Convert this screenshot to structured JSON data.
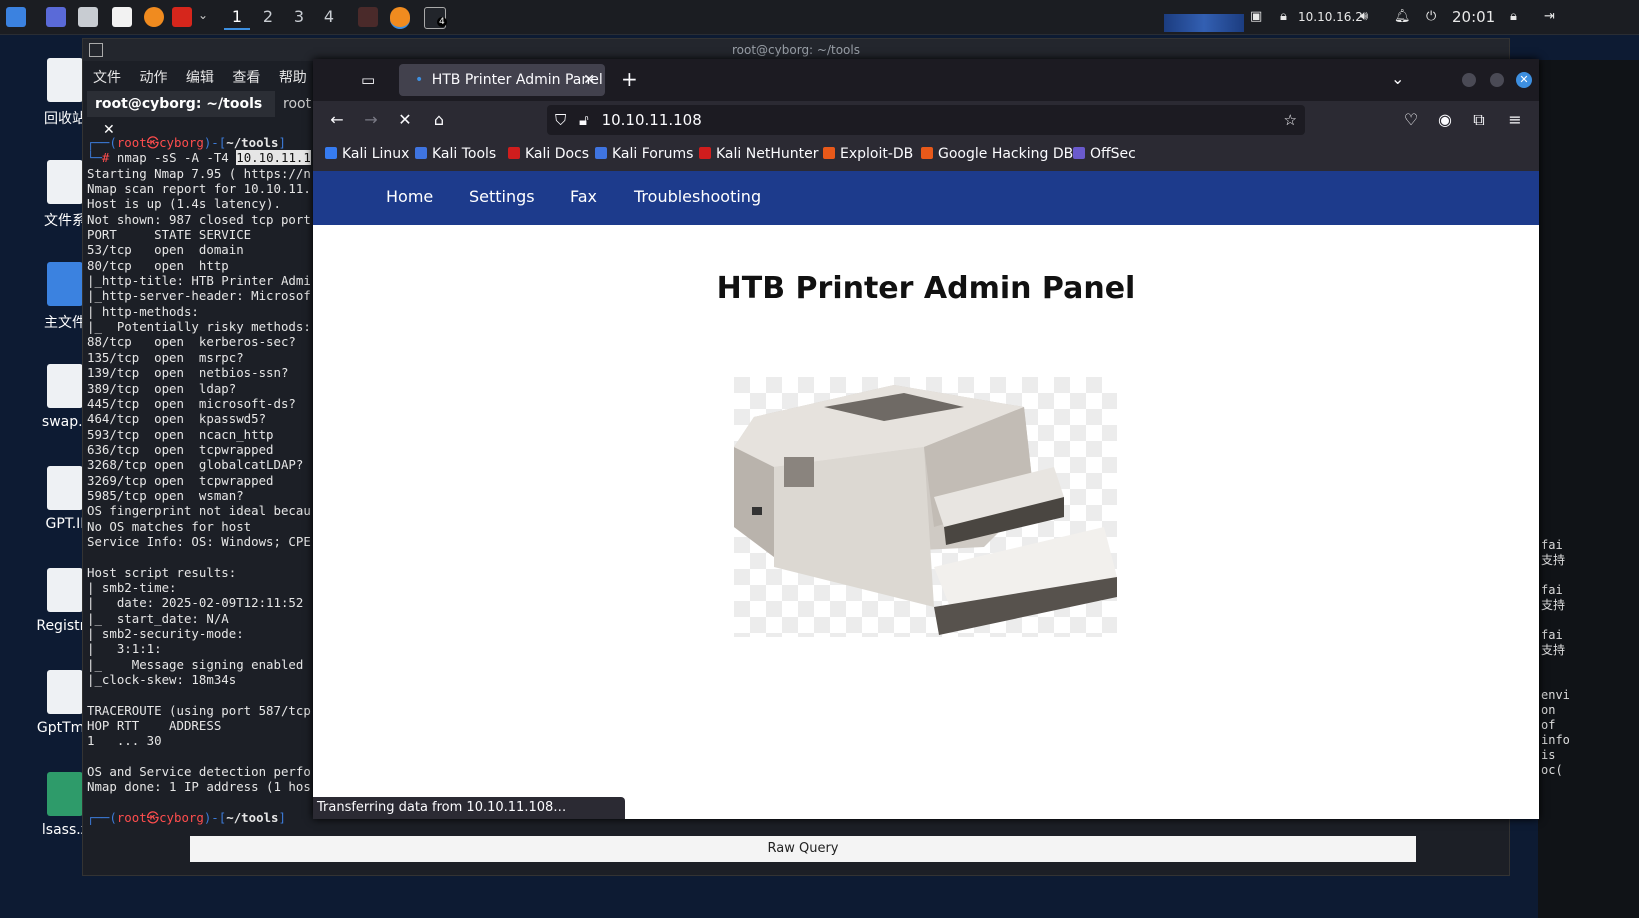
{
  "taskbar": {
    "workspaces": [
      "1",
      "2",
      "3",
      "4"
    ],
    "active_workspace": "1",
    "terminal_badge": "4",
    "ip": "10.10.16.2",
    "time": "20:01"
  },
  "desktop": {
    "items": [
      "回收站",
      "文件系",
      "主文件",
      "swap.t",
      "GPT.II",
      "Registry",
      "GptTmp",
      "lsass.z"
    ]
  },
  "terminal": {
    "title": "root@cyborg: ~/tools",
    "menu": [
      "文件",
      "动作",
      "编辑",
      "查看",
      "帮助"
    ],
    "tab_label": "root@cyborg: ~/tools",
    "tab2_label": "root",
    "prompt_user": "root㉿cyborg",
    "prompt_dir": "~/tools",
    "command": "nmap -sS -A -T4",
    "command_target": "10.10.11.1",
    "output": [
      "Starting Nmap 7.95 ( https://n",
      "Nmap scan report for 10.10.11.",
      "Host is up (1.4s latency).",
      "Not shown: 987 closed tcp port",
      "PORT     STATE SERVICE",
      "53/tcp   open  domain",
      "80/tcp   open  http",
      "|_http-title: HTB Printer Admi",
      "|_http-server-header: Microsof",
      "| http-methods:",
      "|_  Potentially risky methods:",
      "88/tcp   open  kerberos-sec?",
      "135/tcp  open  msrpc?",
      "139/tcp  open  netbios-ssn?",
      "389/tcp  open  ldap?",
      "445/tcp  open  microsoft-ds?",
      "464/tcp  open  kpasswd5?",
      "593/tcp  open  ncacn_http",
      "636/tcp  open  tcpwrapped",
      "3268/tcp open  globalcatLDAP?",
      "3269/tcp open  tcpwrapped",
      "5985/tcp open  wsman?",
      "OS fingerprint not ideal becau",
      "No OS matches for host",
      "Service Info: OS: Windows; CPE",
      "",
      "Host script results:",
      "| smb2-time:",
      "|   date: 2025-02-09T12:11:52",
      "|_  start_date: N/A",
      "| smb2-security-mode:",
      "|   3:1:1:",
      "|_    Message signing enabled",
      "|_clock-skew: 18m34s",
      "",
      "TRACEROUTE (using port 587/tcp",
      "HOP RTT    ADDRESS",
      "1   ... 30",
      "",
      "OS and Service detection perfo",
      "Nmap done: 1 IP address (1 hos"
    ],
    "right_text": "fai\n支持\n\nfai\n支持\n\nfai\n支持\n\n\nenvi\non\nof\ninfo\nis\noc("
  },
  "firefox": {
    "tab_title": "HTB Printer Admin Panel",
    "url": "10.10.11.108",
    "bookmarks": [
      {
        "label": "Kali Linux",
        "color": "#367bf0"
      },
      {
        "label": "Kali Tools",
        "color": "#3f74e0"
      },
      {
        "label": "Kali Docs",
        "color": "#d01d1d"
      },
      {
        "label": "Kali Forums",
        "color": "#3f74e0"
      },
      {
        "label": "Kali NetHunter",
        "color": "#d01d1d"
      },
      {
        "label": "Exploit-DB",
        "color": "#e8591a"
      },
      {
        "label": "Google Hacking DB",
        "color": "#e8591a"
      },
      {
        "label": "OffSec",
        "color": "#6a5acd"
      }
    ],
    "status": "Transferring data from 10.10.11.108…"
  },
  "page": {
    "nav": [
      "Home",
      "Settings",
      "Fax",
      "Troubleshooting"
    ],
    "title": "HTB Printer Admin Panel"
  },
  "bottom": {
    "raw_query": "Raw Query"
  }
}
